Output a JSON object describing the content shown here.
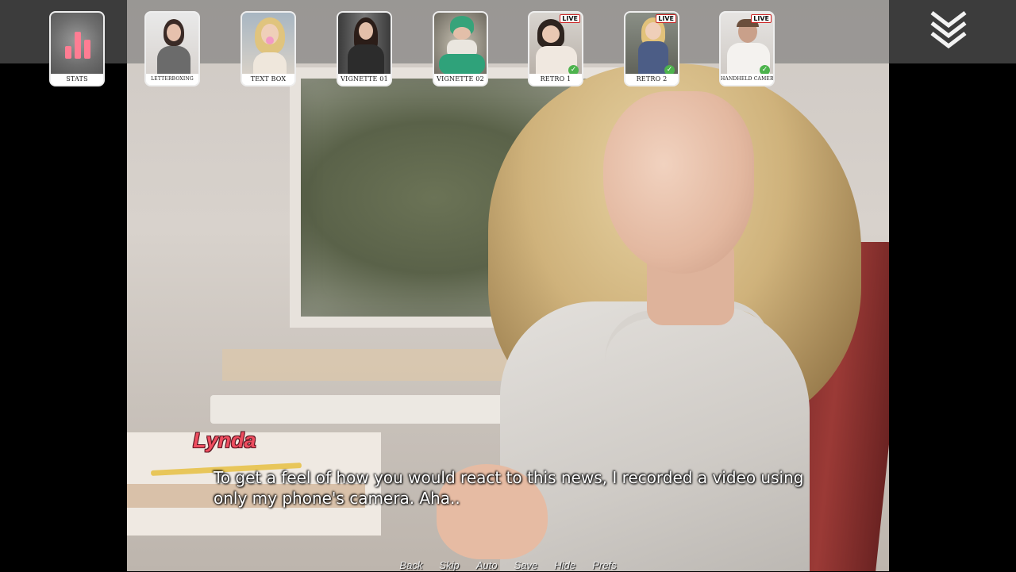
{
  "top_menu": {
    "items": [
      {
        "id": "stats",
        "label": "STATS",
        "live": false,
        "completed": false,
        "icon": "bar-chart-icon"
      },
      {
        "id": "letterboxing",
        "label": "LETTERBOXING",
        "live": false,
        "completed": false
      },
      {
        "id": "text-box",
        "label": "TEXT BOX",
        "live": false,
        "completed": false
      },
      {
        "id": "vignette-01",
        "label": "VIGNETTE 01",
        "live": false,
        "completed": false
      },
      {
        "id": "vignette-02",
        "label": "VIGNETTE 02",
        "live": false,
        "completed": false
      },
      {
        "id": "retro-1",
        "label": "RETRO 1",
        "live": true,
        "completed": true
      },
      {
        "id": "retro-2",
        "label": "RETRO 2",
        "live": true,
        "completed": true
      },
      {
        "id": "handheld-camera",
        "label": "HANDHELD CAMERA",
        "live": true,
        "completed": true
      }
    ],
    "live_badge": "LIVE",
    "collapse_icon": "triple-chevron-down-icon"
  },
  "dialogue": {
    "speaker": "Lynda",
    "text": "To get a feel of how you would react to this news, I recorded a video using only my phone's camera. Aha.."
  },
  "quick_menu": {
    "back": "Back",
    "skip": "Skip",
    "auto": "Auto",
    "save": "Save",
    "hide": "Hide",
    "prefs": "Prefs"
  },
  "colors": {
    "speaker": "#ee4d5f",
    "stats_bars": "#ff7d93",
    "check": "#4db34d"
  }
}
